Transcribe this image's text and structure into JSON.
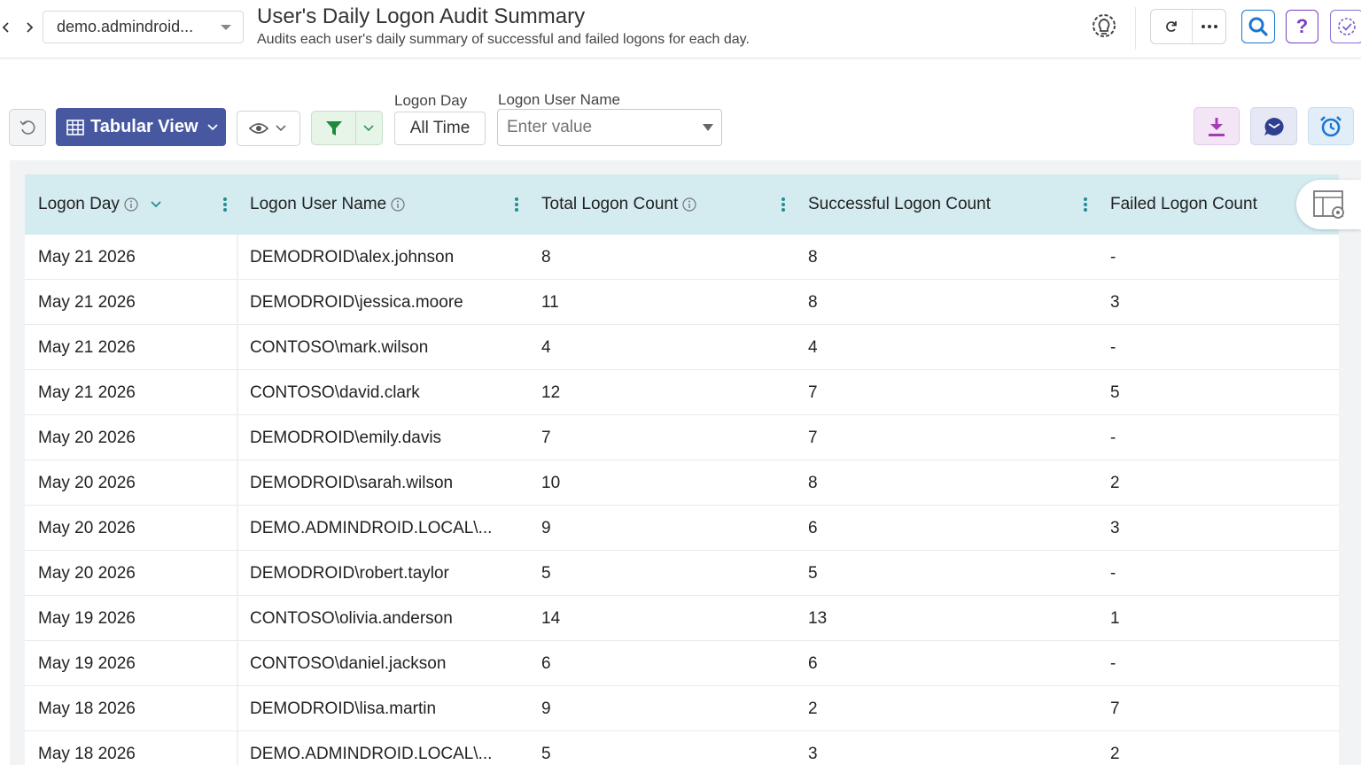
{
  "header": {
    "domain": "demo.admindroid...",
    "title": "User's Daily Logon Audit Summary",
    "subtitle": "Audits each user's daily summary of successful and failed logons for each day."
  },
  "toolbar": {
    "view_label": "Tabular View",
    "filters": [
      {
        "label": "Logon Day",
        "value": "All Time"
      },
      {
        "label": "Logon User Name",
        "placeholder": "Enter value"
      }
    ]
  },
  "colors": {
    "accent": "#4758a1",
    "header_bg": "#d4ebf0",
    "filter_green": "#1f8a3c",
    "search_blue": "#1976d2",
    "help_purple": "#7b3fbf",
    "export_purple": "#a63bb5"
  },
  "icons": [
    "chevron-left-icon",
    "chevron-right-icon",
    "lightbulb-gear-icon",
    "refresh-icon",
    "more-icon",
    "search-icon",
    "help-icon",
    "tasks-icon",
    "reset-icon",
    "table-icon",
    "eye-icon",
    "filter-icon",
    "download-icon",
    "email-icon",
    "schedule-icon",
    "info-icon",
    "column-settings-icon"
  ],
  "table": {
    "columns": [
      "Logon Day",
      "Logon User Name",
      "Total Logon Count",
      "Successful Logon Count",
      "Failed Logon Count"
    ],
    "rows": [
      [
        "May 21 2026",
        "DEMODROID\\alex.johnson",
        "8",
        "8",
        "-"
      ],
      [
        "May 21 2026",
        "DEMODROID\\jessica.moore",
        "11",
        "8",
        "3"
      ],
      [
        "May 21 2026",
        "CONTOSO\\mark.wilson",
        "4",
        "4",
        "-"
      ],
      [
        "May 21 2026",
        "CONTOSO\\david.clark",
        "12",
        "7",
        "5"
      ],
      [
        "May 20 2026",
        "DEMODROID\\emily.davis",
        "7",
        "7",
        "-"
      ],
      [
        "May 20 2026",
        "DEMODROID\\sarah.wilson",
        "10",
        "8",
        "2"
      ],
      [
        "May 20 2026",
        "DEMO.ADMINDROID.LOCAL\\...",
        "9",
        "6",
        "3"
      ],
      [
        "May 20 2026",
        "DEMODROID\\robert.taylor",
        "5",
        "5",
        "-"
      ],
      [
        "May 19 2026",
        "CONTOSO\\olivia.anderson",
        "14",
        "13",
        "1"
      ],
      [
        "May 19 2026",
        "CONTOSO\\daniel.jackson",
        "6",
        "6",
        "-"
      ],
      [
        "May 18 2026",
        "DEMODROID\\lisa.martin",
        "9",
        "2",
        "7"
      ],
      [
        "May 18 2026",
        "DEMO.ADMINDROID.LOCAL\\...",
        "5",
        "3",
        "2"
      ]
    ]
  }
}
